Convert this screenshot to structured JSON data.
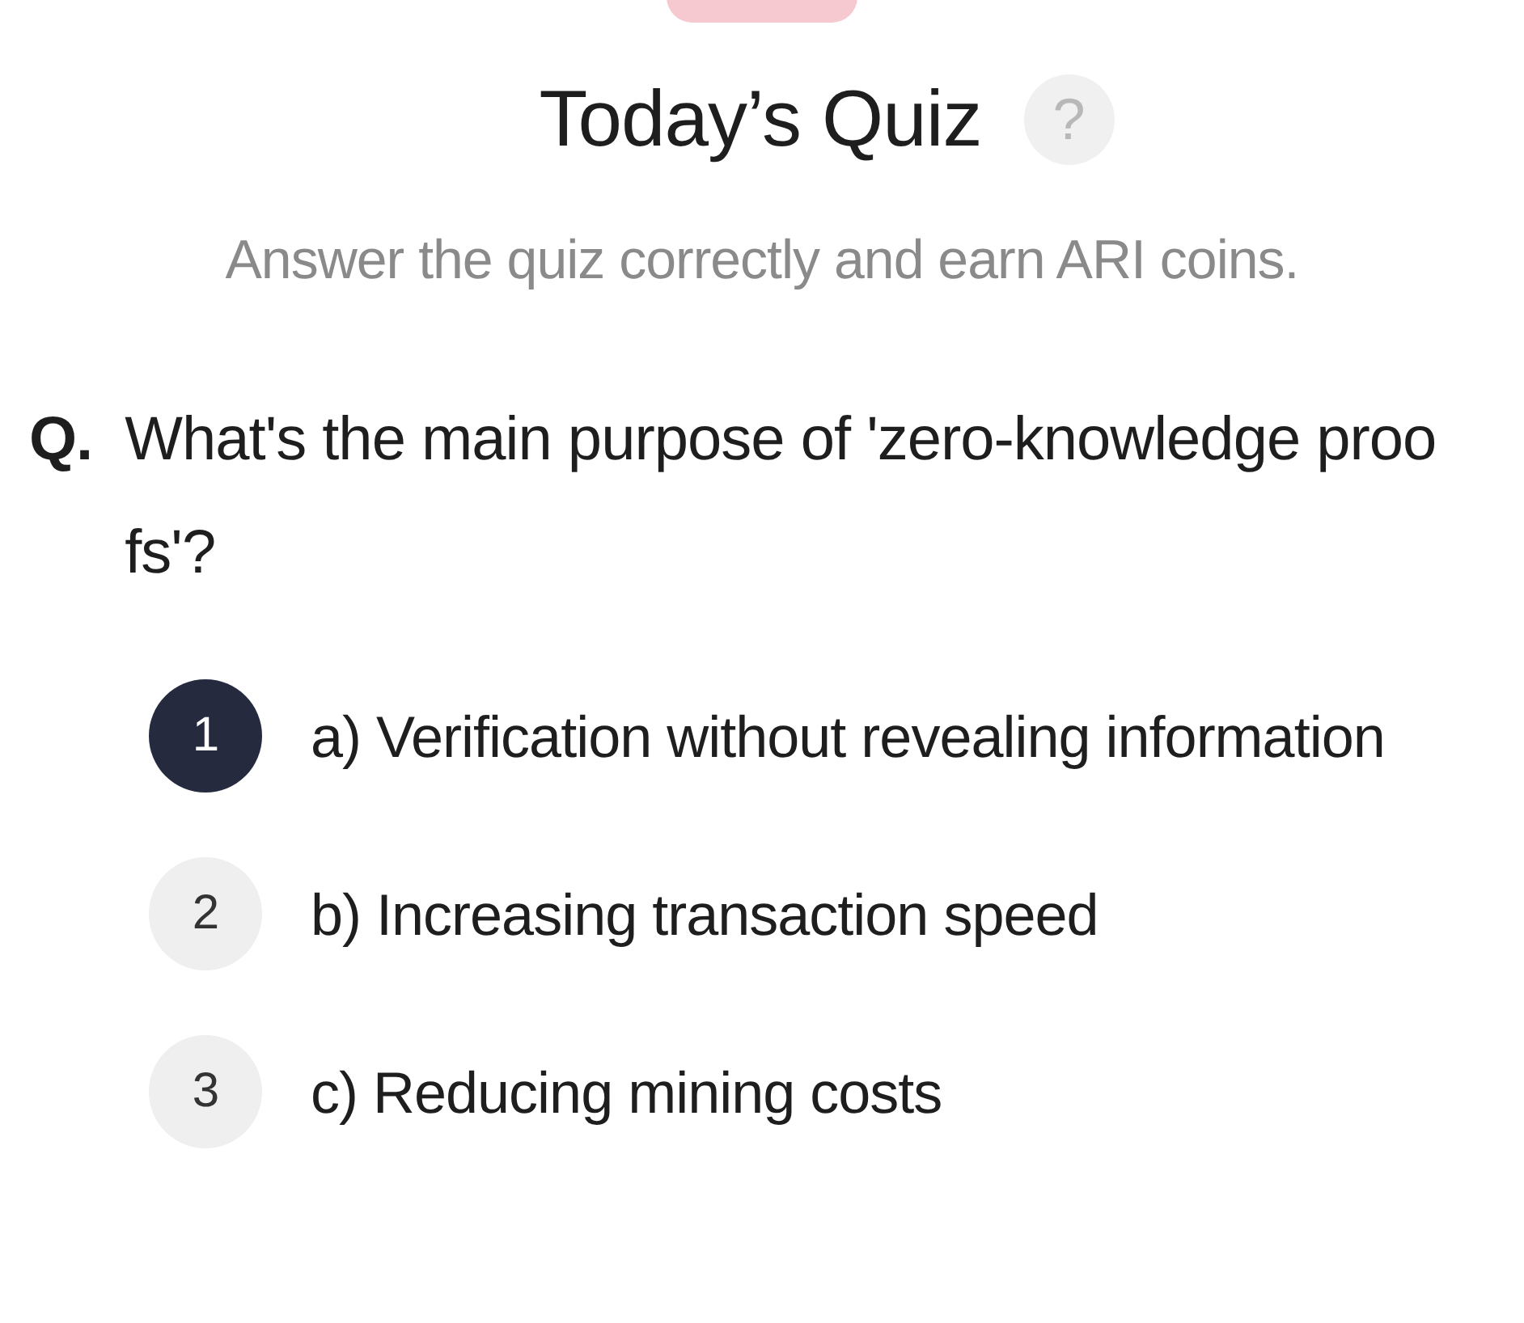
{
  "header": {
    "title": "Today’s Quiz",
    "help": "?",
    "subtitle": "Answer the quiz correctly and earn ARI coins."
  },
  "question": {
    "prefix": "Q.",
    "text": "What's the main purpose of 'zero-knowledge proofs'?"
  },
  "options": [
    {
      "number": "1",
      "text": "a) Verification without revealing information",
      "selected": true
    },
    {
      "number": "2",
      "text": "b) Increasing transaction speed",
      "selected": false
    },
    {
      "number": "3",
      "text": "c) Reducing mining costs",
      "selected": false
    }
  ]
}
